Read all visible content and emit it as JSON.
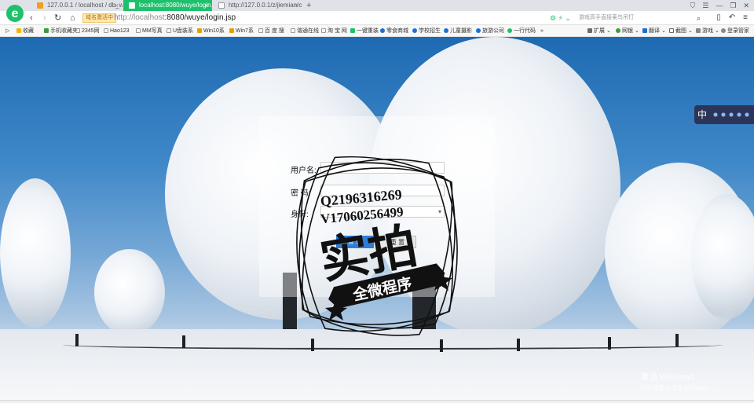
{
  "tabs": [
    {
      "label": "127.0.0.1 / localhost / db_wu",
      "active": false
    },
    {
      "label": "localhost:8080/wuye/login.jsp",
      "active": true
    },
    {
      "label": "http://127.0.0.1/z/jiemian/cre",
      "active": false
    }
  ],
  "address_bar": {
    "tag": "域名激活中",
    "url_host": "http://localhost",
    "url_path": ":8080/wuye/login.jsp",
    "search_placeholder": "游戏高手直接莱鸟吊打"
  },
  "bookmarks": [
    "收藏",
    "手机收藏夹",
    "2345网",
    "Hao123",
    "MM写真",
    "U盘装系",
    "Win10系",
    "Win7系",
    "百 度 搜",
    "谐通在线",
    "淘 宝 网",
    "一键重装",
    "零食商城",
    "学校招生",
    "儿童摄影",
    "旅游公司",
    "一行代码",
    "»"
  ],
  "bookmark_tools": [
    "扩展",
    "网银",
    "翻译",
    "截图",
    "游戏",
    "登录管家"
  ],
  "login": {
    "username_label": "用户名:",
    "password_label": "密 码:",
    "role_label": "身份:",
    "role_value": "",
    "login_button": "登 录",
    "reset_button": "重 置"
  },
  "stamp": {
    "line1": "Q2196316269",
    "line2": "V17060256499",
    "big_text": "实拍",
    "ribbon_text": "全微程序"
  },
  "side_widget": {
    "label": "中"
  },
  "watermark": {
    "title": "激活 Windows",
    "subtitle": "转到\"设置\"以激活 Windows。"
  },
  "colors": {
    "active_tab": "#1ec16b",
    "login_button": "#2e7dd6"
  }
}
